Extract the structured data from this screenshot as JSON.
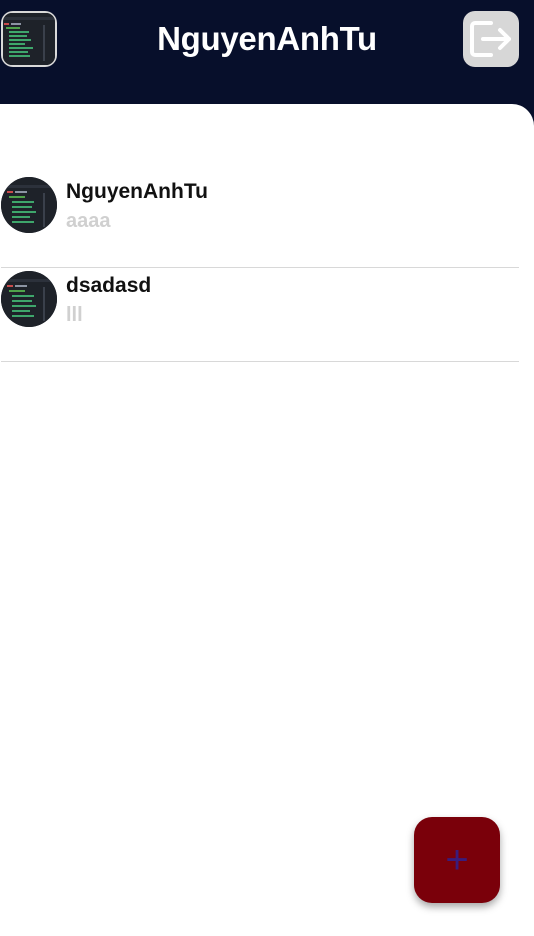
{
  "header": {
    "title": "NguyenAnhTu",
    "avatar_icon": "user-avatar-code-thumbnail",
    "logout_icon": "logout-icon"
  },
  "chats": [
    {
      "name": "NguyenAnhTu",
      "last_message": "aaaa",
      "avatar_icon": "code-thumbnail"
    },
    {
      "name": "dsadasd",
      "last_message": "lll",
      "avatar_icon": "code-thumbnail"
    }
  ],
  "fab": {
    "label": "+",
    "icon": "add-icon"
  },
  "colors": {
    "header_bg": "#070f2b",
    "content_bg": "#ffffff",
    "fab_bg": "#7a000a",
    "fab_icon": "#3a1c7c",
    "muted_text": "#d0d0d0"
  }
}
